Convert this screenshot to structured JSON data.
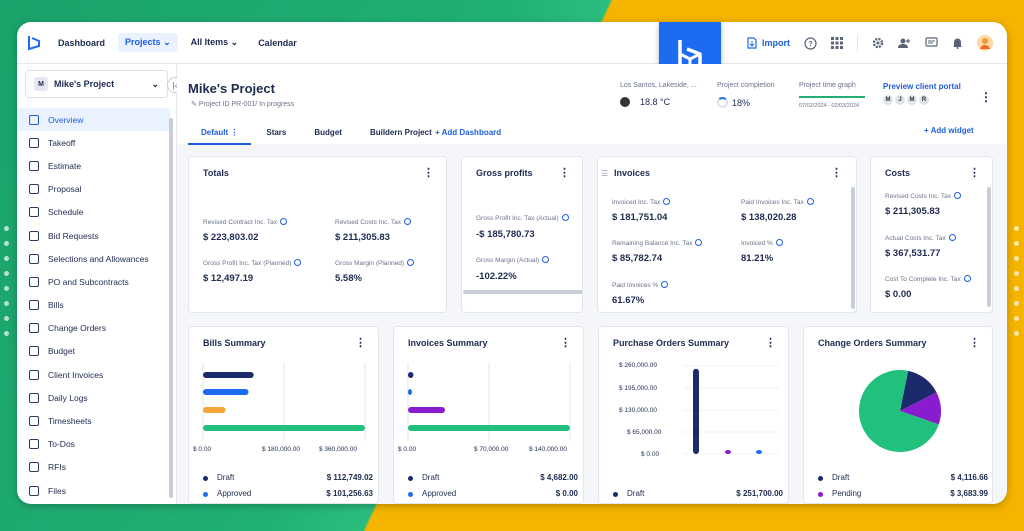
{
  "topbar": {
    "nav": [
      {
        "label": "Dashboard"
      },
      {
        "label": "Projects"
      },
      {
        "label": "All Items"
      },
      {
        "label": "Calendar"
      }
    ],
    "import_label": "Import"
  },
  "sidebar": {
    "project_initial": "M",
    "project_name": "Mike's Project",
    "items": [
      {
        "label": "Overview"
      },
      {
        "label": "Takeoff"
      },
      {
        "label": "Estimate"
      },
      {
        "label": "Proposal"
      },
      {
        "label": "Schedule"
      },
      {
        "label": "Bid Requests"
      },
      {
        "label": "Selections and Allowances"
      },
      {
        "label": "PO and Subcontracts"
      },
      {
        "label": "Bills"
      },
      {
        "label": "Change Orders"
      },
      {
        "label": "Budget"
      },
      {
        "label": "Client Invoices"
      },
      {
        "label": "Daily Logs"
      },
      {
        "label": "Timesheets"
      },
      {
        "label": "To-Dos"
      },
      {
        "label": "RFIs"
      },
      {
        "label": "Files"
      }
    ]
  },
  "header": {
    "title": "Mike's Project",
    "subtitle": "Project ID PR-001/ In progress",
    "weather_location": "Los Santos, Lakeside, ...",
    "temperature": "18.8 °C",
    "completion_label": "Project completion",
    "completion_value": "18%",
    "completion_fraction": 0.18,
    "timegraph_label": "Project time graph",
    "timegraph_dates": "07/02/2024 - 02/03/2024",
    "portal_label": "Preview client portal",
    "avatars": [
      "M",
      "J",
      "M",
      "R"
    ]
  },
  "tabs": [
    {
      "label": "Default"
    },
    {
      "label": "Stars"
    },
    {
      "label": "Budget"
    },
    {
      "label": "Buildern Project"
    }
  ],
  "add_dashboard": "Add Dashboard",
  "add_widget": "Add widget",
  "totals": {
    "title": "Totals",
    "items": [
      {
        "label": "Revised Contract Inc. Tax",
        "value": "$ 223,803.02"
      },
      {
        "label": "Revised Costs Inc. Tax",
        "value": "$ 211,305.83"
      },
      {
        "label": "Gross Profit Inc. Tax (Planned)",
        "value": "$ 12,497.19"
      },
      {
        "label": "Gross Margin (Planned)",
        "value": "5.58%"
      }
    ]
  },
  "gross": {
    "title": "Gross profits",
    "items": [
      {
        "label": "Gross Profit Inc. Tax (Actual)",
        "value": "-$ 185,780.73"
      },
      {
        "label": "Gross Margin (Actual)",
        "value": "-102.22%"
      }
    ]
  },
  "invoices": {
    "title": "Invoices",
    "items": [
      {
        "label": "Invoiced Inc. Tax",
        "value": "$ 181,751.04"
      },
      {
        "label": "Paid Invoices Inc. Tax",
        "value": "$ 138,020.28"
      },
      {
        "label": "Remaining Balance Inc. Tax",
        "value": "$ 85,782.74"
      },
      {
        "label": "Invoiced %",
        "value": "81.21%"
      },
      {
        "label": "Paid Invoices %",
        "value": "61.67%"
      }
    ]
  },
  "costs": {
    "title": "Costs",
    "items": [
      {
        "label": "Revised Costs Inc. Tax",
        "value": "$ 211,305.83"
      },
      {
        "label": "Actual Costs Inc. Tax",
        "value": "$ 367,531.77"
      },
      {
        "label": "Cost To Complete Inc. Tax",
        "value": "$ 0.00"
      }
    ]
  },
  "bills_summary": {
    "title": "Bills Summary",
    "ticks": [
      "$ 0.00",
      "$ 180,000.00",
      "$ 360,000.00"
    ],
    "legend": [
      {
        "name": "Draft",
        "value": "$ 112,749.02",
        "color": "#1b2a6b"
      },
      {
        "name": "Approved",
        "value": "$ 101,256.63",
        "color": "#1d6bf0"
      }
    ]
  },
  "invoices_summary": {
    "title": "Invoices Summary",
    "ticks": [
      "$ 0.00",
      "$ 70,000.00",
      "$ 140,000.00"
    ],
    "legend": [
      {
        "name": "Draft",
        "value": "$ 4,682.00",
        "color": "#1b2a6b"
      },
      {
        "name": "Approved",
        "value": "$ 0.00",
        "color": "#1d6bf0"
      }
    ]
  },
  "po_summary": {
    "title": "Purchase Orders Summary",
    "ticks": [
      "$ 260,000.00",
      "$ 195,000.00",
      "$ 130,000.00",
      "$ 65,000.00",
      "$ 0.00"
    ],
    "legend": [
      {
        "name": "Draft",
        "value": "$ 251,700.00",
        "color": "#1b2a6b"
      }
    ]
  },
  "co_summary": {
    "title": "Change Orders Summary",
    "legend": [
      {
        "name": "Draft",
        "value": "$ 4,116.66",
        "color": "#1b2a6b"
      },
      {
        "name": "Pending",
        "value": "$ 3,683.99",
        "color": "#8a1ccf"
      }
    ]
  },
  "chart_data": [
    {
      "type": "bar",
      "orientation": "horizontal",
      "chart": "Bills Summary",
      "xlim": [
        0,
        360000
      ],
      "series": [
        {
          "name": "Draft",
          "value": 112749.02,
          "color": "#1b2a6b"
        },
        {
          "name": "Approved",
          "value": 101256.63,
          "color": "#1d6bf0"
        },
        {
          "value": 50000,
          "color": "#f6a53b"
        },
        {
          "value": 360000,
          "color": "#21c07c"
        }
      ]
    },
    {
      "type": "bar",
      "orientation": "horizontal",
      "chart": "Invoices Summary",
      "xlim": [
        0,
        140000
      ],
      "series": [
        {
          "name": "Draft",
          "value": 4682,
          "color": "#1b2a6b"
        },
        {
          "name": "Approved",
          "value": 0,
          "color": "#1d6bf0"
        },
        {
          "value": 32000,
          "color": "#8a1ccf"
        },
        {
          "value": 140000,
          "color": "#21c07c"
        }
      ]
    },
    {
      "type": "bar",
      "orientation": "vertical",
      "chart": "Purchase Orders Summary",
      "ylim": [
        0,
        260000
      ],
      "series": [
        {
          "name": "Draft",
          "value": 251700,
          "color": "#1b2a6b"
        },
        {
          "value": 5000,
          "color": "#8a1ccf"
        },
        {
          "value": 1500,
          "color": "#1d6bf0"
        }
      ]
    },
    {
      "type": "pie",
      "chart": "Change Orders Summary",
      "slices": [
        {
          "name": "Draft",
          "value": 4116.66,
          "color": "#1b2a6b"
        },
        {
          "name": "Pending",
          "value": 3683.99,
          "color": "#8a1ccf"
        },
        {
          "value": 21000,
          "color": "#21c07c"
        }
      ]
    }
  ]
}
